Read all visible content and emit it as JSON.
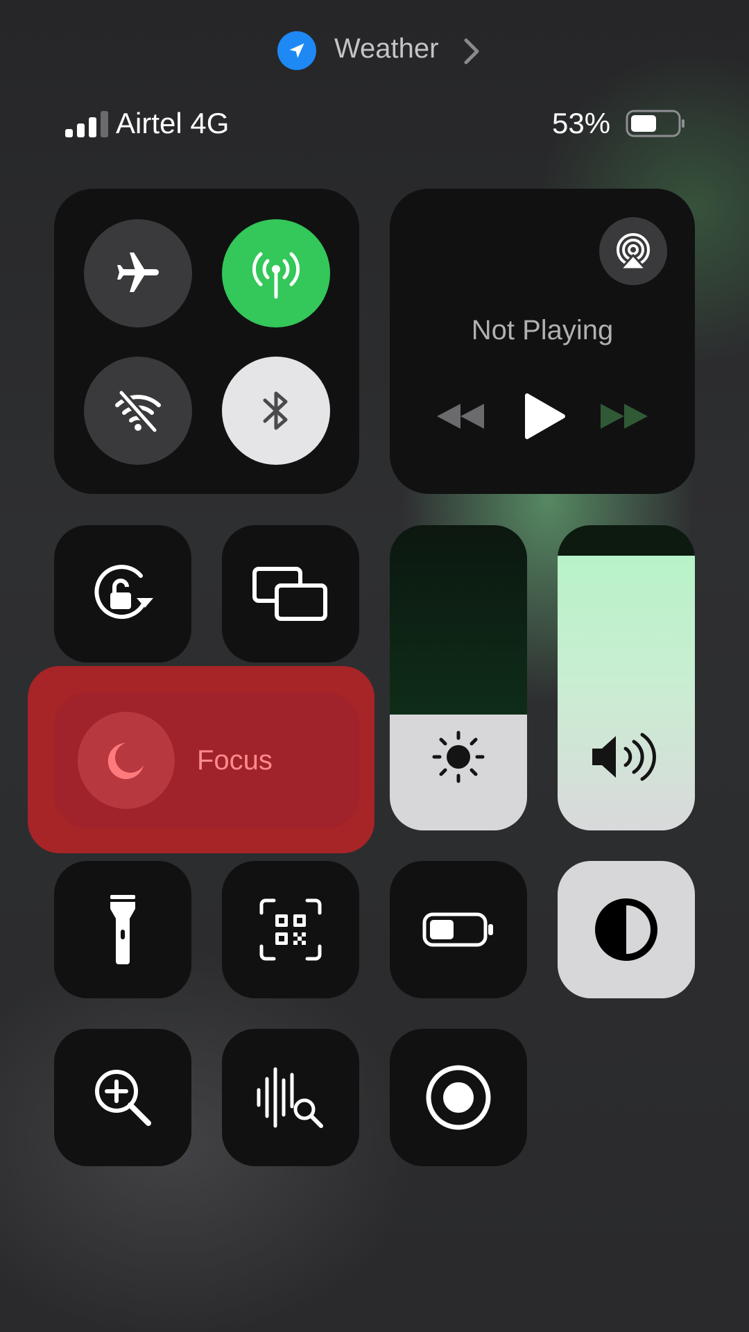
{
  "location_banner": {
    "app_name": "Weather",
    "icon": "location-arrow-icon",
    "chevron": "chevron-right-icon",
    "accent": "#1E88F5"
  },
  "status_bar": {
    "carrier": "Airtel 4G",
    "signal_bars": 3,
    "battery_percent": "53%",
    "battery_level": 0.53
  },
  "connectivity": {
    "airplane": {
      "icon": "airplane-icon",
      "on": false
    },
    "cellular": {
      "icon": "cellular-antenna-icon",
      "on": true,
      "color": "#34C759"
    },
    "wifi": {
      "icon": "wifi-off-icon",
      "on": false
    },
    "bluetooth": {
      "icon": "bluetooth-icon",
      "on": true
    }
  },
  "media": {
    "status": "Not Playing",
    "airplay_icon": "airplay-icon",
    "controls": [
      "rewind-icon",
      "play-icon",
      "fast-forward-icon"
    ]
  },
  "focus": {
    "label": "Focus",
    "icon": "moon-icon",
    "color": "#A72427"
  },
  "sliders": {
    "brightness": {
      "icon": "sun-icon",
      "level": 0.38
    },
    "volume": {
      "icon": "speaker-icon",
      "level": 0.9
    }
  },
  "toggles": [
    "orientation-lock-icon",
    "screen-mirroring-icon",
    "flashlight-icon",
    "qr-code-scanner-icon",
    "low-power-mode-icon",
    "dark-mode-icon",
    "magnifier-icon",
    "sound-recognition-icon",
    "screen-recording-icon"
  ]
}
